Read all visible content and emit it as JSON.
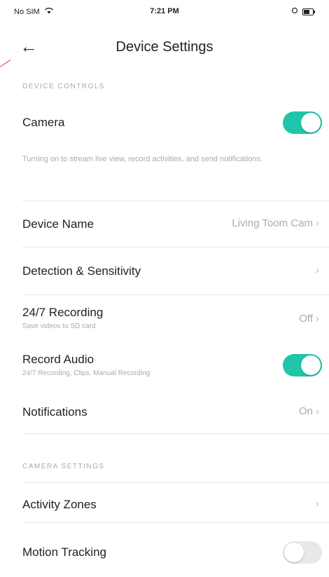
{
  "status_bar": {
    "carrier": "No SIM",
    "wifi_icon": "wifi-icon",
    "time": "7:21 PM",
    "right_icon": "location-icon",
    "battery_icon": "battery-icon"
  },
  "header": {
    "back_icon": "back-arrow-icon",
    "title": "Device Settings"
  },
  "sections": {
    "device_controls": "DEVICE CONTROLS",
    "camera_settings": "CAMERA SETTINGS"
  },
  "camera": {
    "label": "Camera",
    "enabled": true,
    "description": "Turning on to stream live view, record activities, and send notifications."
  },
  "device_name": {
    "label": "Device Name",
    "value": "Living Toom Cam"
  },
  "detection": {
    "label": "Detection & Sensitivity"
  },
  "recording": {
    "label": "24/7 Recording",
    "subtitle": "Save videos to SD card",
    "value": "Off"
  },
  "record_audio": {
    "label": "Record Audio",
    "subtitle": "24/7 Recording, Clips, Manual Recording",
    "enabled": true
  },
  "notifications": {
    "label": "Notifications",
    "value": "On"
  },
  "activity_zones": {
    "label": "Activity Zones"
  },
  "motion_tracking": {
    "label": "Motion Tracking",
    "enabled": false
  },
  "chevron": "›",
  "colors": {
    "accent": "#1fc5a9",
    "toggle_off": "#e8e8e8",
    "muted_text": "#aaaaaa"
  }
}
